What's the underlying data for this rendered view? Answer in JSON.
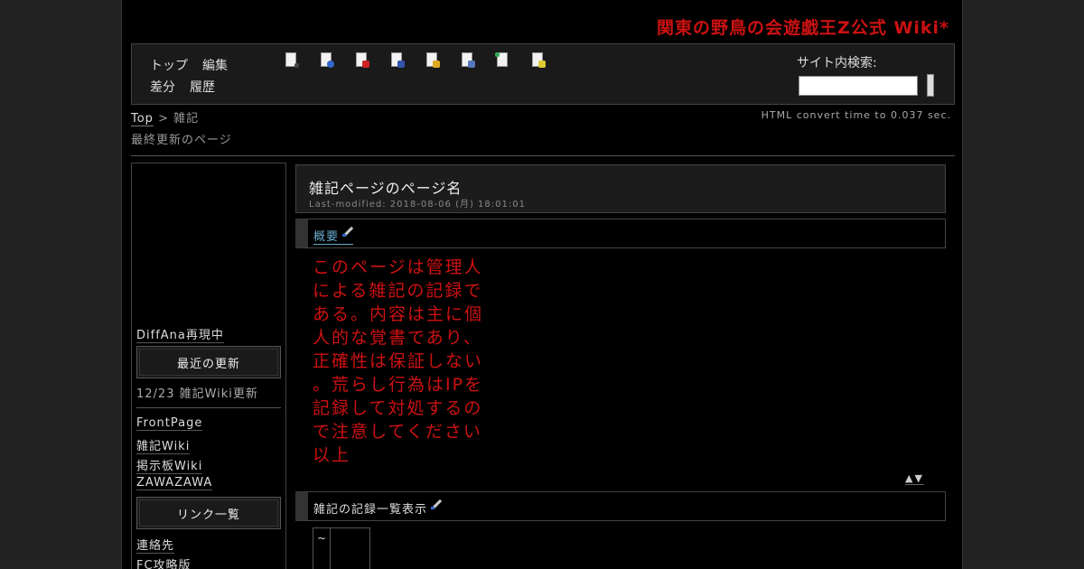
{
  "site": {
    "title": "関東の野鳥の会遊戯王Z公式 Wiki*"
  },
  "nav": {
    "links": [
      "トップ",
      "編集",
      "差分",
      "履歴"
    ]
  },
  "toolbar": {
    "icons": [
      "new-page-icon",
      "reload-icon",
      "diff-icon",
      "backup-icon",
      "freeze-icon",
      "copy-icon",
      "list-icon",
      "help-icon"
    ]
  },
  "search": {
    "label": "サイト内検索:"
  },
  "breadcrumb": {
    "top": "Top",
    "sep": " > ",
    "current": "雑記"
  },
  "subcrumb": "最終更新のページ",
  "convert_time": "HTML convert time to 0.037 sec.",
  "sidebar": {
    "diff_link": "DiffAna再現中",
    "button1": "最近の更新",
    "news": "12/23  雑記Wiki更新",
    "links": [
      "FrontPage",
      "雑記Wiki",
      "掲示板Wiki",
      "ZAWAZAWA"
    ],
    "button2": "リンク一覧",
    "links2": [
      "連絡先",
      "FC攻略版"
    ]
  },
  "main": {
    "title": "雑記ページのページ名",
    "last_modified": "Last-modified: 2018-08-06 (月) 18:01:01",
    "section1": "概要",
    "red_lines": [
      "このページは管理人",
      "による雑記の記録で",
      "ある。内容は主に個",
      "人的な覚書であり、",
      "正確性は保証しない",
      "。荒らし行為はIPを",
      "記録して対処するの",
      "で注意してください",
      "以上"
    ],
    "arrows": "▲▼",
    "section2": "雑記の記録一覧表示",
    "table_cell": "~"
  }
}
